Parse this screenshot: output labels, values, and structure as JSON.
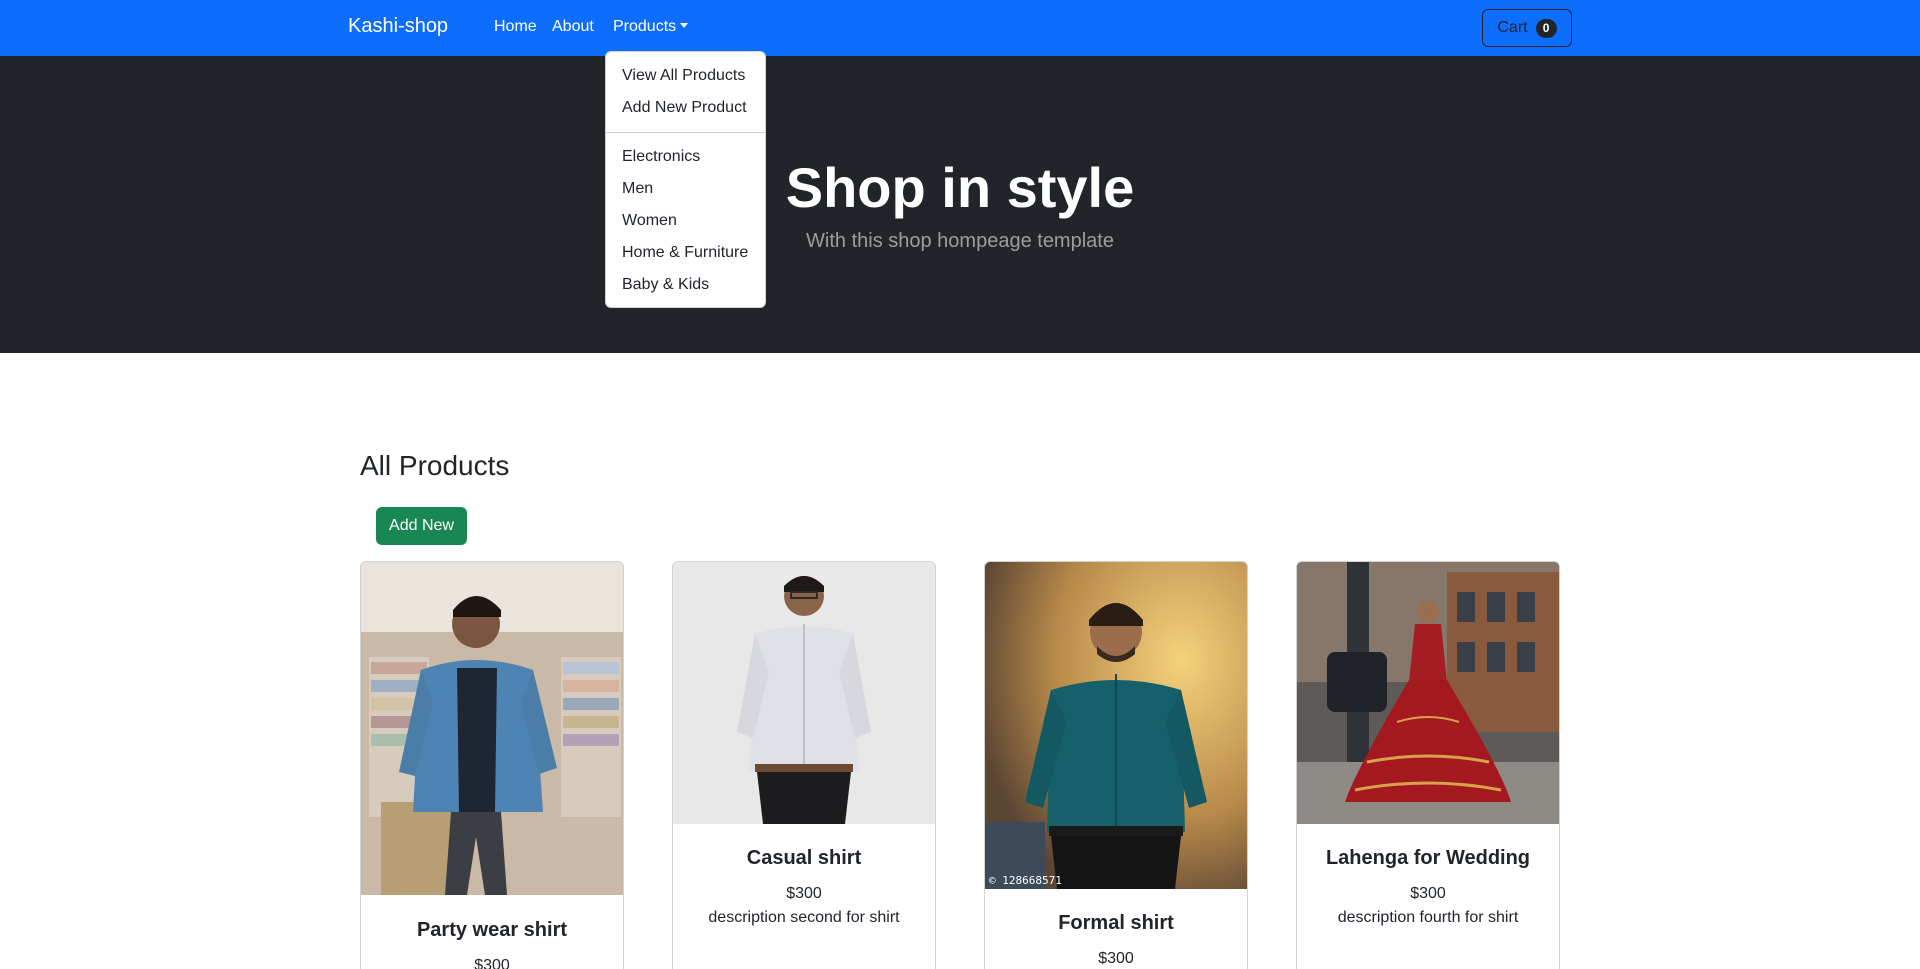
{
  "navbar": {
    "brand": "Kashi-shop",
    "links": {
      "home": "Home",
      "about": "About",
      "products": "Products"
    },
    "cart": {
      "label": "Cart",
      "count": "0"
    }
  },
  "dropdown": {
    "primary": [
      "View All Products",
      "Add New Product"
    ],
    "categories": [
      "Electronics",
      "Men",
      "Women",
      "Home & Furniture",
      "Baby & Kids"
    ]
  },
  "hero": {
    "title": "Shop in style",
    "subtitle": "With this shop hompeage template"
  },
  "products_section": {
    "title": "All Products",
    "add_button": "Add New",
    "cards": [
      {
        "title": "Party wear shirt",
        "price": "$300",
        "description": ""
      },
      {
        "title": "Casual shirt",
        "price": "$300",
        "description": "description second for shirt"
      },
      {
        "title": "Formal shirt",
        "price": "$300",
        "description": "",
        "image_caption": "128668571"
      },
      {
        "title": "Lahenga for Wedding",
        "price": "$300",
        "description": "description fourth for shirt"
      }
    ]
  },
  "colors": {
    "primary": "#0d6efd",
    "dark": "#212529",
    "success": "#198754"
  }
}
